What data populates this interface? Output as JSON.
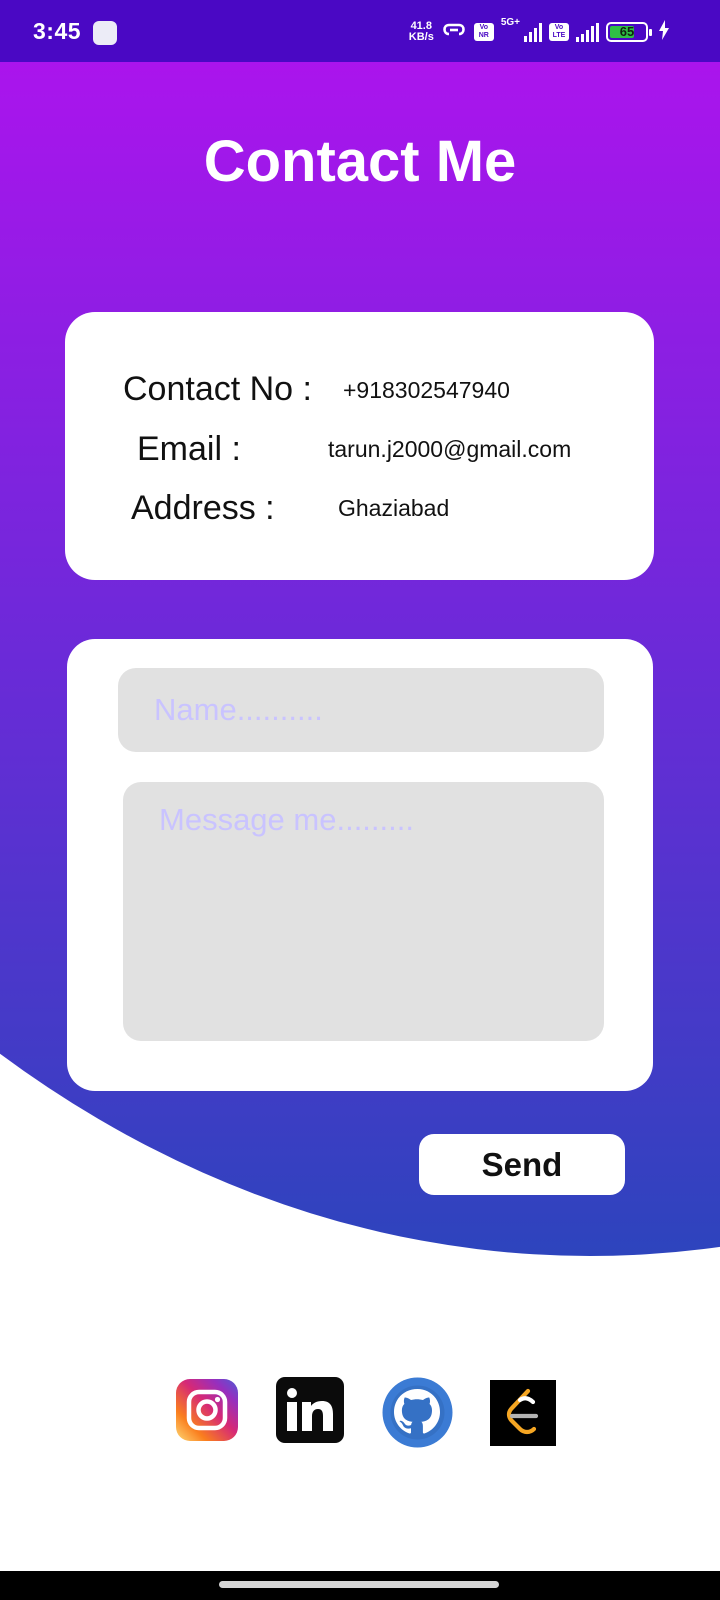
{
  "status_bar": {
    "time": "3:45",
    "net_speed_value": "41.8",
    "net_speed_unit": "KB/s",
    "sim1_badge": "Vo NR",
    "sim1_network": "5G+",
    "sim2_badge": "Vo LTE",
    "battery_percent": "65"
  },
  "page": {
    "title": "Contact Me"
  },
  "contact_info": {
    "phone_label": "Contact No :",
    "phone_value": "+918302547940",
    "email_label": "Email :",
    "email_value": "tarun.j2000@gmail.com",
    "address_label": "Address :",
    "address_value": "Ghaziabad"
  },
  "form": {
    "name_placeholder": "Name..........",
    "name_value": "",
    "message_placeholder": "Message me.........",
    "message_value": "",
    "send_label": "Send"
  },
  "social_links": [
    {
      "icon": "instagram-icon"
    },
    {
      "icon": "linkedin-icon",
      "label": "in"
    },
    {
      "icon": "github-icon"
    },
    {
      "icon": "leetcode-icon"
    }
  ],
  "colors": {
    "status_bar_bg": "#4a08c4",
    "gradient_top": "#ab14ed",
    "gradient_mid": "#6b2ad8",
    "gradient_bottom": "#2d44bd",
    "card_bg": "#ffffff",
    "input_bg": "#e1e1e1",
    "placeholder": "#c9c3ff"
  }
}
